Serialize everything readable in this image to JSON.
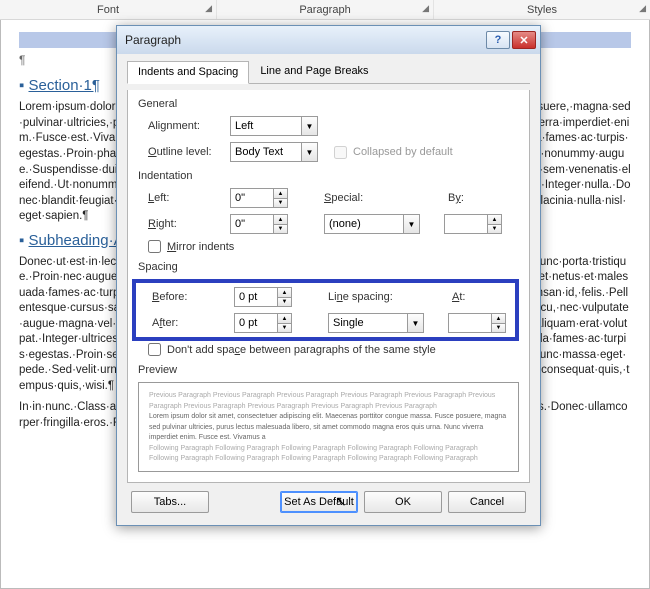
{
  "ribbon": {
    "font": "Font",
    "paragraph": "Paragraph",
    "styles": "Styles"
  },
  "doc": {
    "section1": "Section·1¶",
    "subheading": "Subheading·A¶",
    "p1": "Lorem·ipsum·dolor·sit·amet,·consectetur·adipiscing·elit.·Maecenas·porttitor·congue·massa.·Fusce·posuere,·magna·sed·pulvinar·ultricies,·purus·lectus·malesuada·libero,·sit·amet·commodo·magna·eros·quis·urna.·Nunc·viverra·imperdiet·enim.·Fusce·est.·Vivamus·a·tellus.·Pellentesque·habitant·morbi·tristique·senectus·et·netus·et·malesuada·fames·ac·turpis·egestas.·Proin·pharetra·nonummy·pede.·Mauris·et·orci.·Aenean·nec·lorem.·In·porttitor.·Donec·laoreet·nonummy·augue.·Suspendisse·dui·purus,·scelerisque·at,·vulputate·vitae,·pretium·mattis,·nunc.·Mauris·eget·neque·at·sem·venenatis·eleifend.·Ut·nonummy.·Fusce·aliquet·pede·non·pede.·Suspendisse·dapibus·lorem·pellentesque·magna.·Integer·nulla.·Donec·blandit·feugiat·ligula.·Donec·hendrerit,·felis·et·imperdiet·euismod,·purus·ipsum·pretium·metus,·in·lacinia·nulla·nisl·eget·sapien.¶",
    "p2": "Donec·ut·est·in·lectus·consequat·consequat.·Etiam·eget·dui.·Aliquam·erat·volutpat.·Sed·at·lorem·in·nunc·porta·tristique.·Proin·nec·augue.·Quisque·aliquam·tempor·magna.·Pellentesque·habitant·morbi·tristique·senectus·et·netus·et·malesuada·fames·ac·turpis·egestas.·Nunc·ac·magna.·Maecenas·odio·dolor,·vulputate·vel,·auctor·ac,·accumsan·id,·felis.·Pellentesque·cursus·sagittis·felis.·Pellentesque·porttitor,·velit·lacinia·egestas·auctor,·diam·eros·tempus·arcu,·nec·vulputate·augue·magna·vel·risus.·Cras·non·magna·vel·ante·adipiscing·rhoncus.·Vivamus·a·mi.·Morbi·neque.·Aliquam·erat·volutpat.·Integer·ultrices·lobortis·eros.·Pellentesque·habitant·morbi·tristique·senectus·et·netus·et·malesuada·fames·ac·turpis·egestas.·Proin·semper,·ante·vitae·sollicitudin·posuere,·metus·quam·iaculis·nibh,·vitae·scelerisque·nunc·massa·eget·pede.·Sed·velit·urna,·interdum·vel,·ultricies·vel,·faucibus·at,·quam.·Donec·elit·est,·consectetuer·eget,·consequat·quis,·tempus·quis,·wisi.¶",
    "p3": "In·in·nunc.·Class·aptent·taciti·sociosqu·ad·litora·torquent·per·conubia·nostra,·per·inceptos·hymenaeos.·Donec·ullamcorper·fringilla·eros.·Fusce·in·sapien·eu·purus·dapibus·commodo.·Cum·sociis·natoque"
  },
  "dialog": {
    "title": "Paragraph",
    "tabs": {
      "t1": "Indents and Spacing",
      "t2": "Line and Page Breaks"
    },
    "general": {
      "label": "General",
      "alignment_label": "Alignment:",
      "alignment_value": "Left",
      "outline_label": "Outline level:",
      "outline_value": "Body Text",
      "collapsed_label": "Collapsed by default"
    },
    "indent": {
      "label": "Indentation",
      "left_label": "Left:",
      "left_value": "0\"",
      "right_label": "Right:",
      "right_value": "0\"",
      "special_label": "Special:",
      "special_value": "(none)",
      "by_label": "By:",
      "by_value": "",
      "mirror_label": "Mirror indents"
    },
    "spacing": {
      "label": "Spacing",
      "before_label": "Before:",
      "before_value": "0 pt",
      "after_label": "After:",
      "after_value": "0 pt",
      "line_label": "Line spacing:",
      "line_value": "Single",
      "at_label": "At:",
      "at_value": "",
      "same_style_label": "Don't add space between paragraphs of the same style"
    },
    "preview": {
      "label": "Preview",
      "prev": "Previous Paragraph Previous Paragraph Previous Paragraph Previous Paragraph Previous Paragraph Previous Paragraph Previous Paragraph Previous Paragraph Previous Paragraph Previous Paragraph",
      "sample": "Lorem ipsum dolor sit amet, consectetuer adipiscing elit. Maecenas porttitor congue massa. Fusce posuere, magna sed pulvinar ultricies, purus lectus malesuada libero, sit amet commodo magna eros quis urna. Nunc viverra imperdiet enim. Fusce est. Vivamus a",
      "next": "Following Paragraph Following Paragraph Following Paragraph Following Paragraph Following Paragraph Following Paragraph Following Paragraph Following Paragraph Following Paragraph Following Paragraph"
    },
    "buttons": {
      "tabs": "Tabs...",
      "default": "Set As Default",
      "ok": "OK",
      "cancel": "Cancel"
    }
  }
}
